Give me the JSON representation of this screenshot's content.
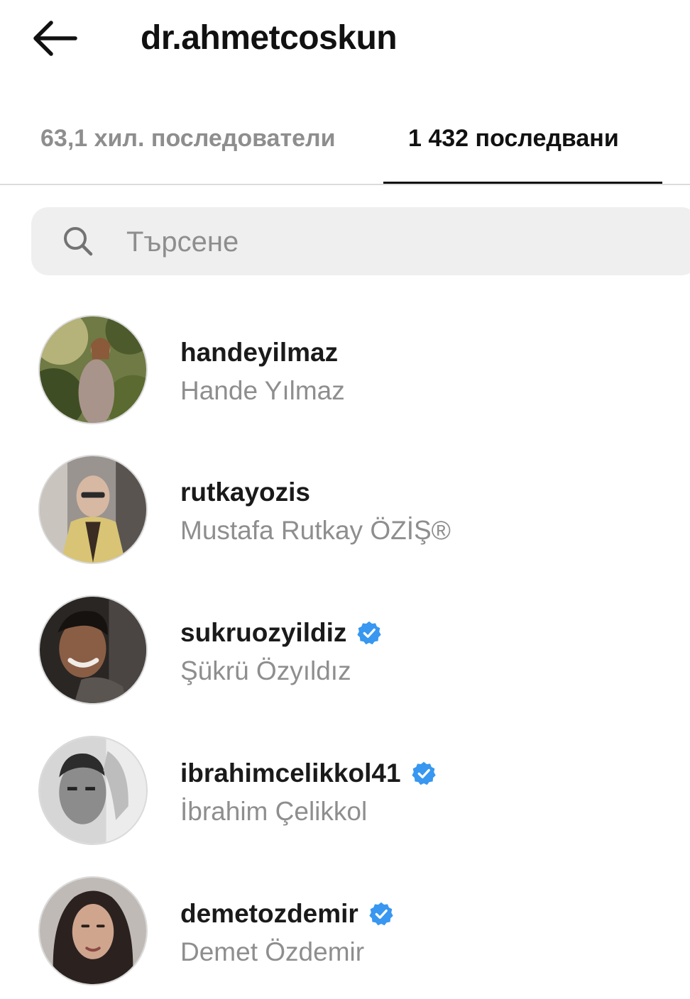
{
  "header": {
    "title": "dr.ahmetcoskun",
    "back_icon": "arrow-left-icon"
  },
  "tabs": [
    {
      "label": "63,1 хил. последователи",
      "active": false
    },
    {
      "label": "1 432 последвани",
      "active": true
    }
  ],
  "search": {
    "placeholder": "Търсене",
    "value": "",
    "icon": "search-icon"
  },
  "list": [
    {
      "username": "handeyilmaz",
      "full_name": "Hande Yılmaz",
      "verified": false
    },
    {
      "username": "rutkayozis",
      "full_name": "Mustafa Rutkay ÖZİŞ®",
      "verified": false
    },
    {
      "username": "sukruozyildiz",
      "full_name": "Şükrü Özyıldız",
      "verified": true
    },
    {
      "username": "ibrahimcelikkol41",
      "full_name": "İbrahim Çelikkol",
      "verified": true
    },
    {
      "username": "demetozdemir",
      "full_name": "Demet Özdemir",
      "verified": true
    }
  ],
  "colors": {
    "verified": "#3897f0",
    "muted_text": "#8e8e8e",
    "primary_text": "#111111",
    "search_bg": "#efefef"
  }
}
